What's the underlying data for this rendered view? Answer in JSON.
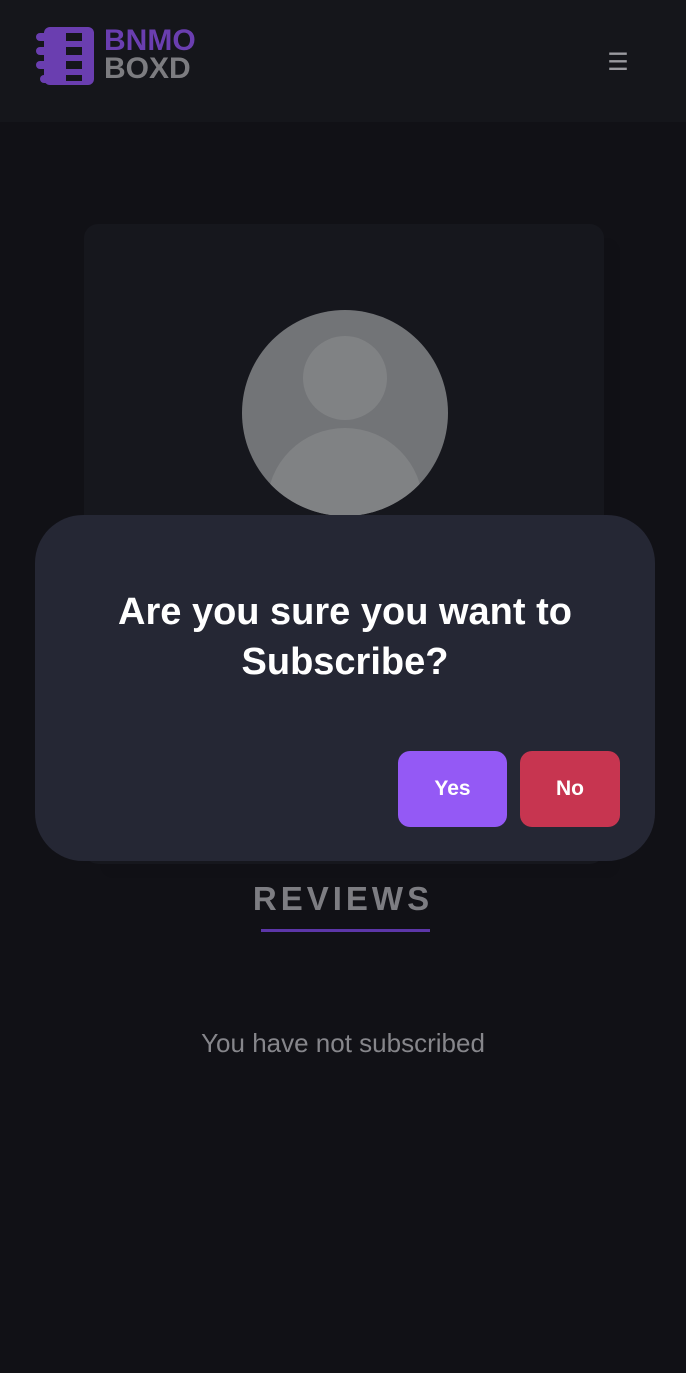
{
  "header": {
    "logo_line1": "BNMO",
    "logo_line2": "BOXD",
    "menu_icon": "hamburger-icon",
    "menu_glyph": "☰"
  },
  "colors": {
    "brand_purple": "#6a3eb0",
    "yes_button": "#9459f5",
    "no_button": "#c73550",
    "modal_bg": "#252734"
  },
  "modal": {
    "title": "Are you sure you want to Subscribe?",
    "yes_label": "Yes",
    "no_label": "No"
  },
  "reviews": {
    "title": "REVIEWS",
    "empty_message": "You have not subscribed"
  }
}
